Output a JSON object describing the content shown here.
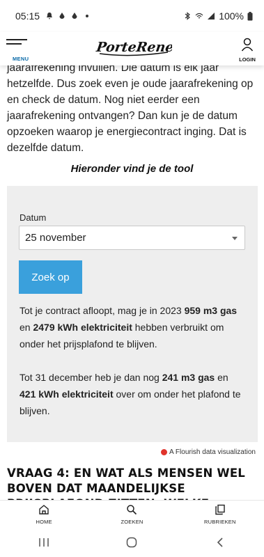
{
  "status_bar": {
    "time": "05:15",
    "battery": "100%"
  },
  "top_nav": {
    "menu_label": "MENU",
    "logo_text": "PorteRenee",
    "login_label": "LOGIN"
  },
  "article": {
    "paragraph": "jaarafrekening invullen. Die datum is elk jaar hetzelfde. Dus zoek even je oude jaarafrekening op en check de datum. Nog niet eerder een jaarafrekening ontvangen? Dan kun je de datum opzoeken waarop je energiecontract inging. Dat is dezelfde datum.",
    "tool_heading": "Hieronder vind je de tool"
  },
  "tool": {
    "datum_label": "Datum",
    "datum_value": "25 november",
    "button_label": "Zoek op",
    "result1": {
      "t1": "Tot je contract afloopt, mag je in 2023 ",
      "gas": "959 m3 gas",
      "t2": " en ",
      "elec": "2479 kWh elektriciteit",
      "t3": " hebben verbruikt om onder het prijsplafond te blijven."
    },
    "result2": {
      "t1": "Tot 31 december heb je dan nog ",
      "gas": "241 m3 gas",
      "t2": " en ",
      "elec": "421 kWh elektriciteit",
      "t3": " over om onder het plafond te blijven."
    }
  },
  "flourish_credit": "A Flourish data visualization",
  "next_heading": "VRAAG 4: EN WAT ALS MENSEN WEL BOVEN DAT MAANDELIJKSE PRIJSPLAFOND ZITTEN, WELKE",
  "bottom_nav": {
    "items": [
      {
        "label": "HOME",
        "icon": "home-icon"
      },
      {
        "label": "ZOEKEN",
        "icon": "search-icon"
      },
      {
        "label": "RUBRIEKEN",
        "icon": "copy-icon"
      }
    ]
  }
}
